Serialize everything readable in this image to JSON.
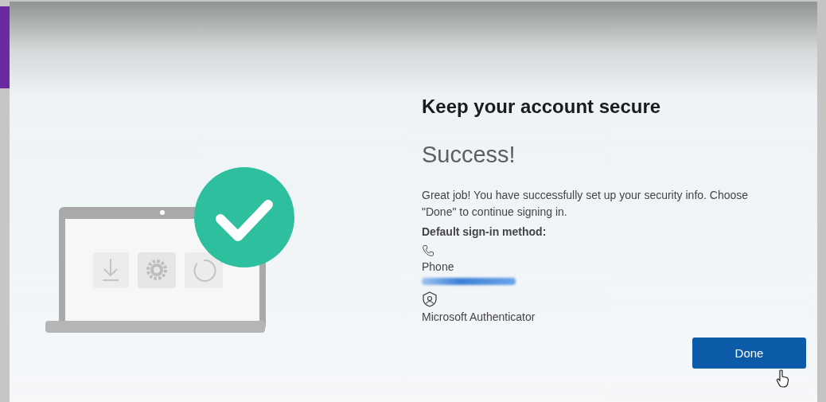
{
  "page": {
    "title": "Keep your account secure",
    "status": "Success!",
    "message": "Great job! You have successfully set up your security info. Choose \"Done\" to continue signing in.",
    "default_method_label": "Default sign-in method:",
    "methods": [
      {
        "kind": "phone",
        "label": "Phone",
        "redacted": true
      },
      {
        "kind": "authenticator",
        "label": "Microsoft Authenticator",
        "redacted": false
      }
    ]
  },
  "done_button": "Done"
}
